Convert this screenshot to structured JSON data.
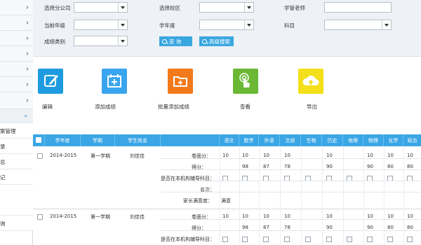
{
  "sidebar": {
    "open_item_chevron": "chevron-down-icon",
    "sub_items": [
      "案管理",
      "录",
      "总",
      "记",
      "",
      "询"
    ]
  },
  "filters": {
    "branch_label": "选择分公司",
    "campus_label": "选择校区",
    "teacher_label": "学管老师",
    "grade_label": "当前年级",
    "year_label": "学年度",
    "subject_label": "科目",
    "score_type_label": "成绩类别",
    "query_button": "查 询",
    "advanced_button": "高级搜索"
  },
  "actions": [
    {
      "label": "编辑",
      "icon": "edit-icon",
      "color": "#1e9be0"
    },
    {
      "label": "添加成绩",
      "icon": "calendar-add-icon",
      "color": "#3aa5ee"
    },
    {
      "label": "批量添加成绩",
      "icon": "folder-add-icon",
      "color": "#f27a1a"
    },
    {
      "label": "查看",
      "icon": "touch-icon",
      "color": "#6ab834"
    },
    {
      "label": "导出",
      "icon": "cloud-upload-icon",
      "color": "#f3e01b"
    }
  ],
  "table": {
    "headers": [
      "学年度",
      "学期",
      "学生姓名",
      "语文",
      "数学",
      "外语",
      "文综",
      "生物",
      "历史",
      "地理",
      "物理",
      "化学",
      "政治"
    ],
    "row_labels": [
      "卷面分：",
      "得分：",
      "是否在本机构辅导科目：",
      "名次：",
      "家长满意度："
    ],
    "records": [
      {
        "year": "2014-2015",
        "term": "第一学期",
        "name": "刘佳佳",
        "full_marks": [
          "10",
          "10",
          "10",
          "10",
          "",
          "10",
          "",
          "10",
          "10",
          "10"
        ],
        "scores": [
          "",
          "98",
          "87",
          "78",
          "",
          "90",
          "",
          "90",
          "80",
          "80"
        ],
        "satisfaction": "满意"
      },
      {
        "year": "2014-2015",
        "term": "第一学期",
        "name": "刘佳佳",
        "full_marks": [
          "10",
          "10",
          "10",
          "10",
          "",
          "10",
          "",
          "10",
          "10",
          "10"
        ],
        "scores": [
          "",
          "98",
          "87",
          "78",
          "",
          "90",
          "",
          "90",
          "80",
          "80"
        ],
        "satisfaction": ""
      }
    ]
  }
}
